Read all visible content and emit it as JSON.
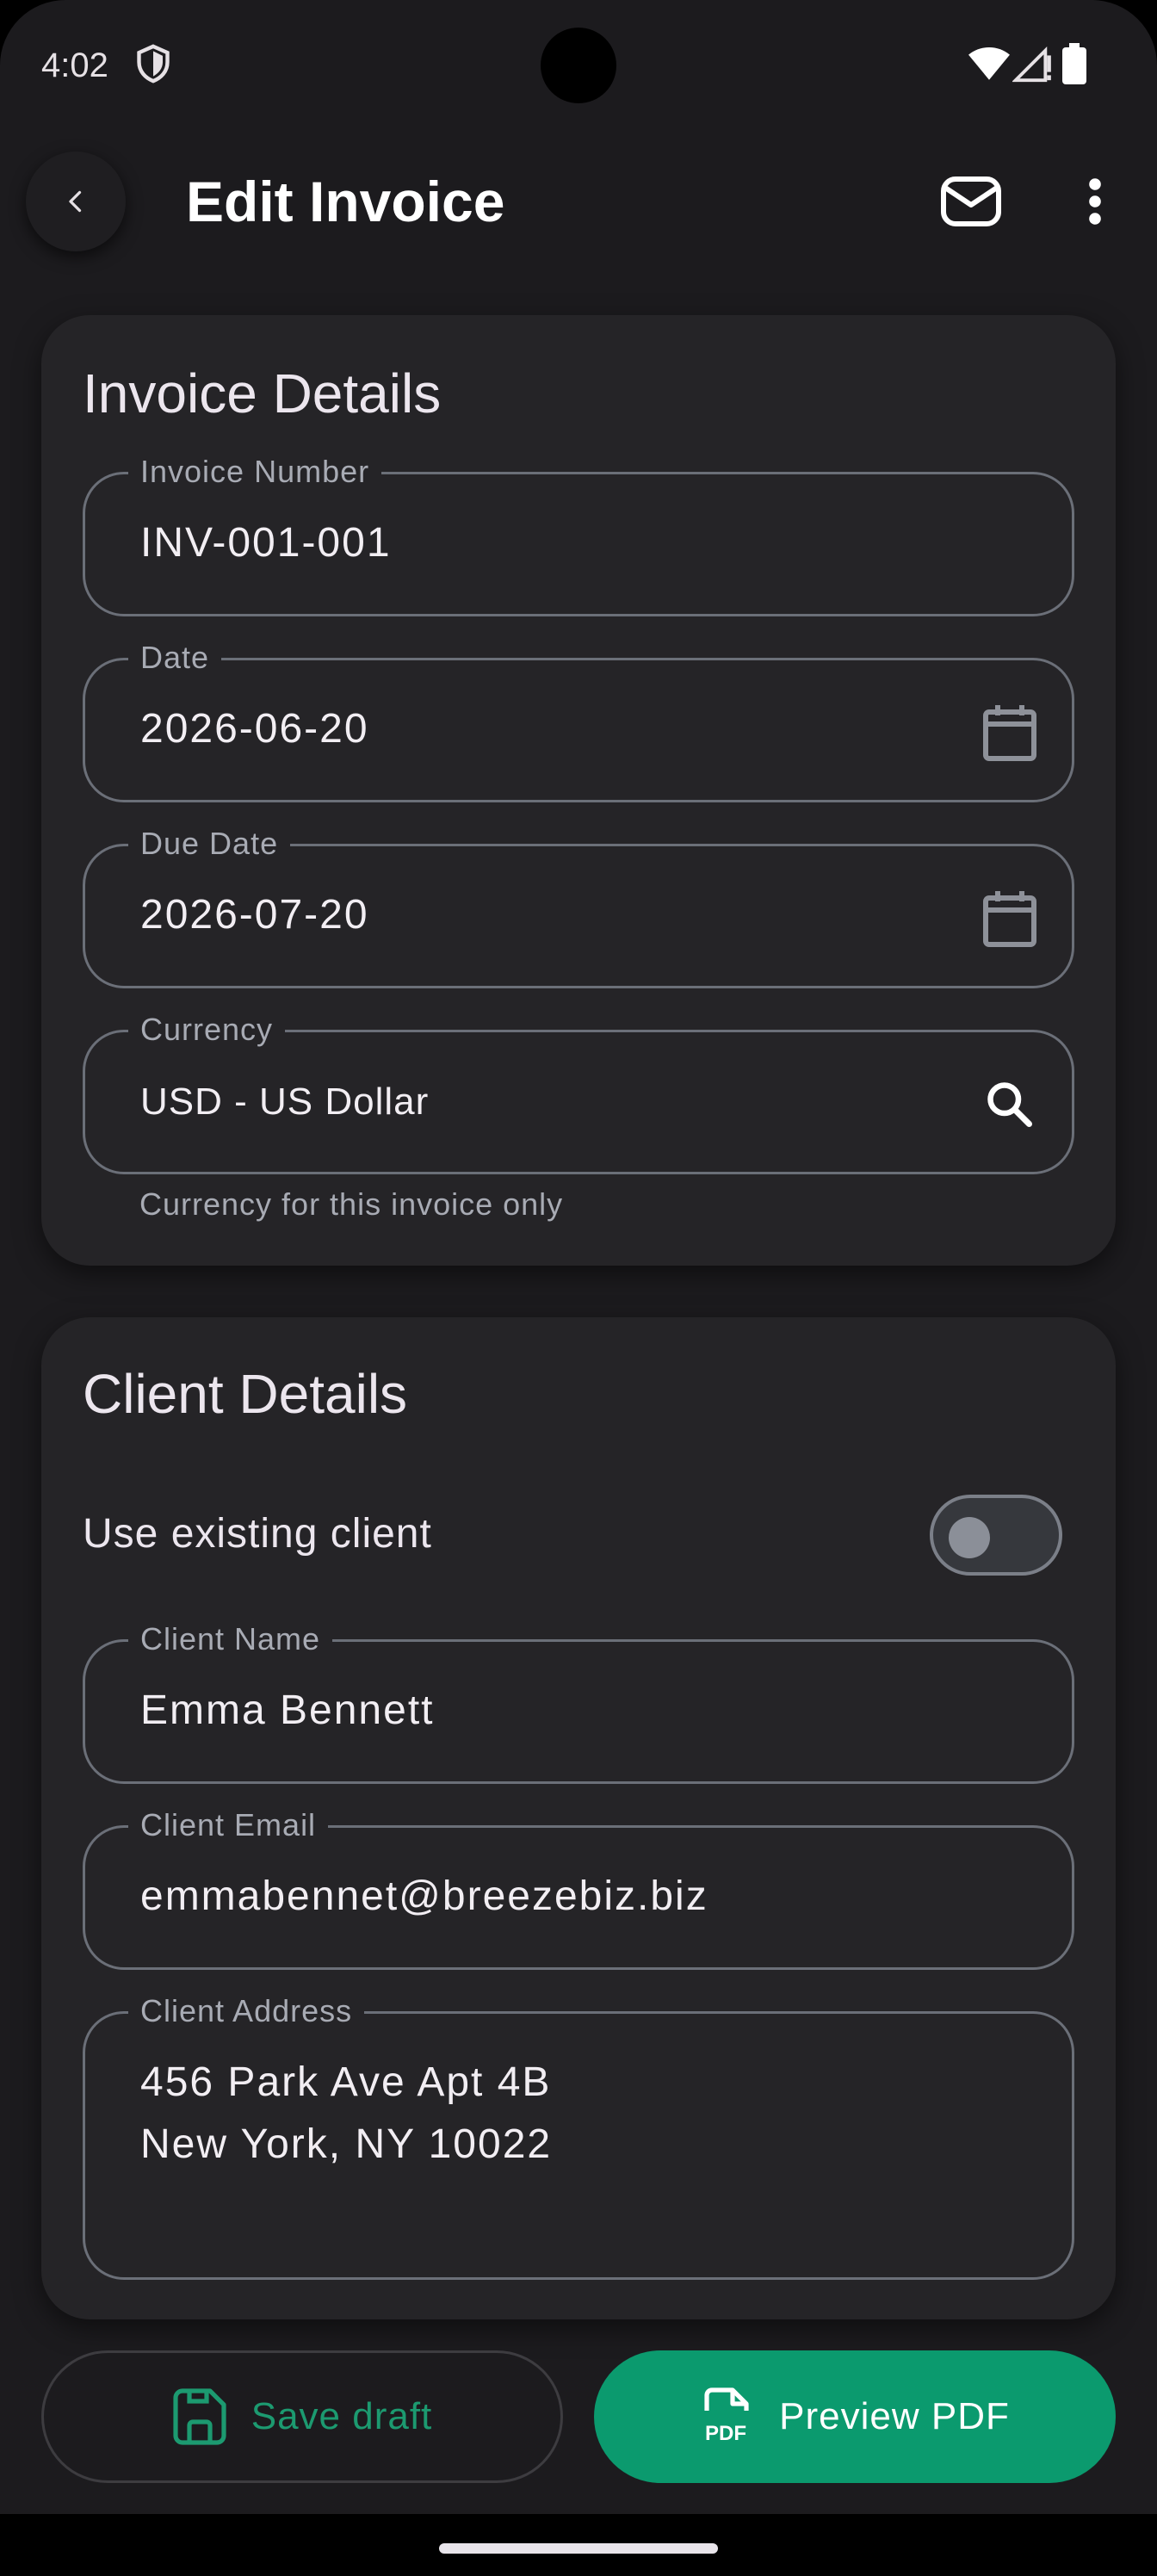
{
  "status_bar": {
    "time": "4:02"
  },
  "app_bar": {
    "title": "Edit Invoice"
  },
  "invoice_details": {
    "title": "Invoice Details",
    "invoice_number": {
      "label": "Invoice Number",
      "value": "INV-001-001"
    },
    "date": {
      "label": "Date",
      "value": "2026-06-20"
    },
    "due_date": {
      "label": "Due Date",
      "value": "2026-07-20"
    },
    "currency": {
      "label": "Currency",
      "value": "USD - US Dollar",
      "helper": "Currency for this invoice only"
    }
  },
  "client_details": {
    "title": "Client Details",
    "use_existing_client": {
      "label": "Use existing client",
      "on": false
    },
    "client_name": {
      "label": "Client Name",
      "value": "Emma Bennett"
    },
    "client_email": {
      "label": "Client Email",
      "value": "emmabennet@breezebiz.biz"
    },
    "client_address": {
      "label": "Client Address",
      "lines": [
        "456 Park Ave Apt 4B",
        "New York, NY 10022"
      ]
    }
  },
  "actions": {
    "save_draft": "Save draft",
    "preview_pdf": "Preview PDF",
    "pdf_badge": "PDF"
  },
  "colors": {
    "accent": "#0b9a6e",
    "accent_text": "#1c9a70",
    "background": "#1c1b1e",
    "card": "#252427"
  },
  "icons": {
    "back": "chevron-left-icon",
    "mail": "mail-icon",
    "more": "more-vert-icon",
    "calendar": "calendar-icon",
    "search": "search-icon",
    "save": "save-icon",
    "pdf": "pdf-file-icon"
  }
}
